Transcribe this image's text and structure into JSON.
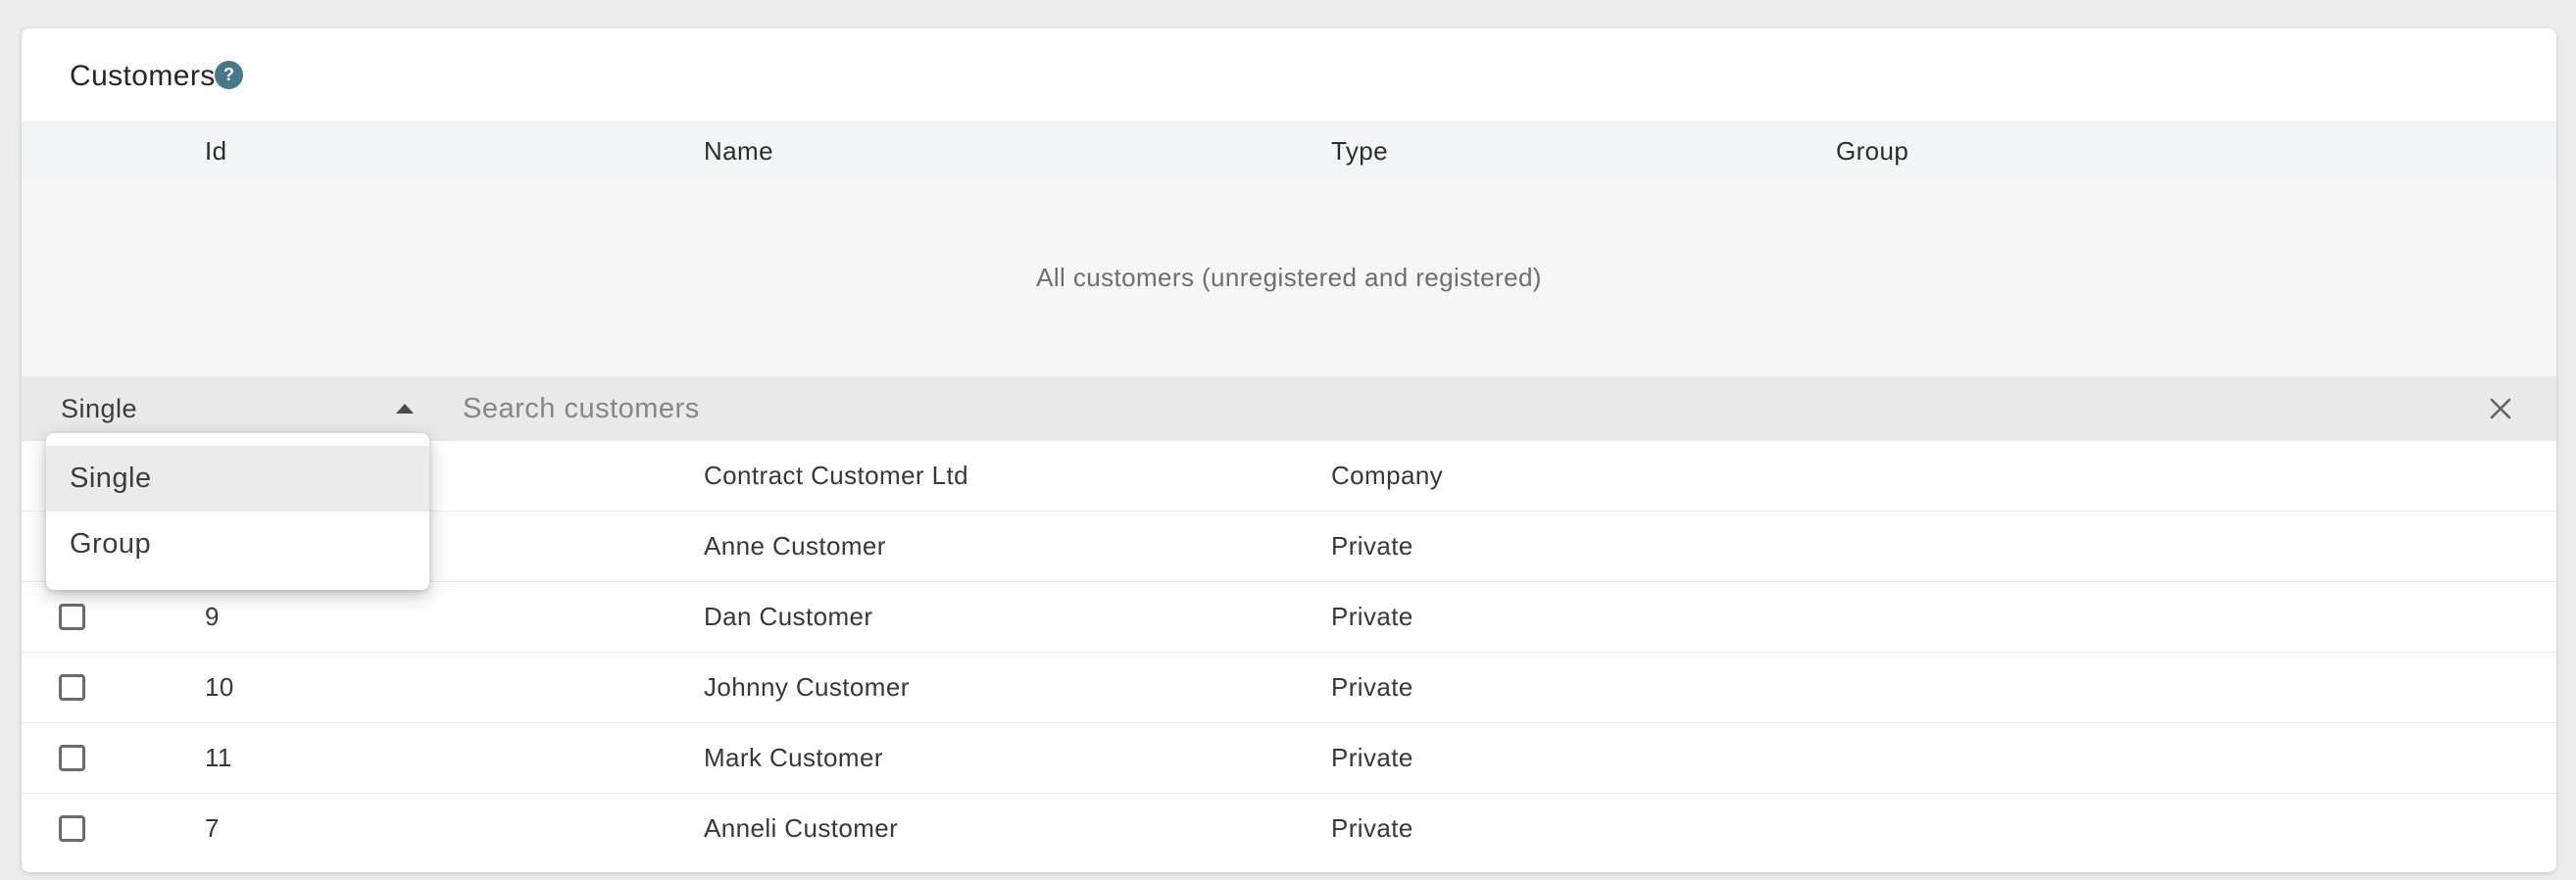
{
  "header": {
    "title": "Customers",
    "help_icon": "?"
  },
  "table": {
    "columns": [
      "Id",
      "Name",
      "Type",
      "Group"
    ],
    "empty_state_text": "All customers (unregistered and registered)",
    "rows": [
      {
        "id": "",
        "name": "Contract Customer Ltd",
        "type": "Company",
        "group": ""
      },
      {
        "id": "",
        "name": "Anne Customer",
        "type": "Private",
        "group": ""
      },
      {
        "id": "9",
        "name": "Dan Customer",
        "type": "Private",
        "group": ""
      },
      {
        "id": "10",
        "name": "Johnny Customer",
        "type": "Private",
        "group": ""
      },
      {
        "id": "11",
        "name": "Mark Customer",
        "type": "Private",
        "group": ""
      },
      {
        "id": "7",
        "name": "Anneli Customer",
        "type": "Private",
        "group": ""
      }
    ]
  },
  "filter_bar": {
    "type_filter_value": "Single",
    "search_placeholder": "Search customers"
  },
  "type_dropdown": {
    "options": [
      {
        "label": "Single",
        "highlighted": true
      },
      {
        "label": "Group",
        "highlighted": false
      }
    ]
  },
  "colors": {
    "accent_teal": "#45788b",
    "page_background": "#ececec",
    "header_row_background": "#f2f6f7",
    "empty_zone_background": "#f7f6f6",
    "filter_bar_background": "#e9e9e9",
    "highlighted_option_background": "#ebebeb"
  }
}
